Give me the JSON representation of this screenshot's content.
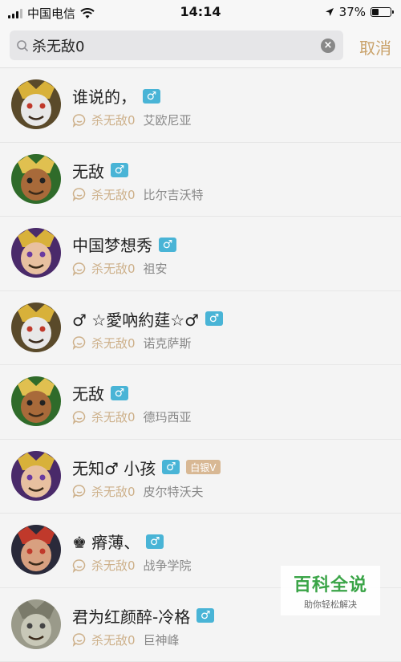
{
  "status_bar": {
    "carrier": "中国电信",
    "time": "14:14",
    "battery_percent": "37%",
    "battery_level": 0.37
  },
  "search": {
    "query": "杀无敌0",
    "cancel_label": "取消"
  },
  "results": [
    {
      "name": "谁说的，",
      "gender": "♂",
      "rank": "",
      "keyword": "杀无敌0",
      "region": "艾欧尼亚",
      "avatar_theme": "wolf-gold"
    },
    {
      "name": "无敌",
      "gender": "♂",
      "rank": "",
      "keyword": "杀无敌0",
      "region": "比尔吉沃特",
      "avatar_theme": "monkey-green"
    },
    {
      "name": "中国梦想秀",
      "gender": "♂",
      "rank": "",
      "keyword": "杀无敌0",
      "region": "祖安",
      "avatar_theme": "warrior-purple"
    },
    {
      "name": "♂ ☆愛吶約莛☆♂",
      "gender": "♂",
      "rank": "",
      "keyword": "杀无敌0",
      "region": "诺克萨斯",
      "avatar_theme": "wolf-gold"
    },
    {
      "name": "无敌",
      "gender": "♂",
      "rank": "",
      "keyword": "杀无敌0",
      "region": "德玛西亚",
      "avatar_theme": "monkey-green"
    },
    {
      "name": "无知♂ 小孩",
      "gender": "♂",
      "rank": "白银V",
      "keyword": "杀无敌0",
      "region": "皮尔特沃夫",
      "avatar_theme": "warrior-purple"
    },
    {
      "name": "♚ 瘠薄、",
      "gender": "♂",
      "rank": "",
      "keyword": "杀无敌0",
      "region": "战争学院",
      "avatar_theme": "dark-red"
    },
    {
      "name": "君为红颜醉-冷格",
      "gender": "♂",
      "rank": "",
      "keyword": "杀无敌0",
      "region": "巨神峰",
      "avatar_theme": "grey-photo"
    }
  ],
  "watermark": {
    "title": "百科全说",
    "subtitle": "助你轻松解决"
  },
  "colors": {
    "accent_gold": "#c9a26a",
    "gender_badge": "#49b4d6",
    "rank_badge": "#d8b894",
    "watermark_green": "#3aa447"
  }
}
